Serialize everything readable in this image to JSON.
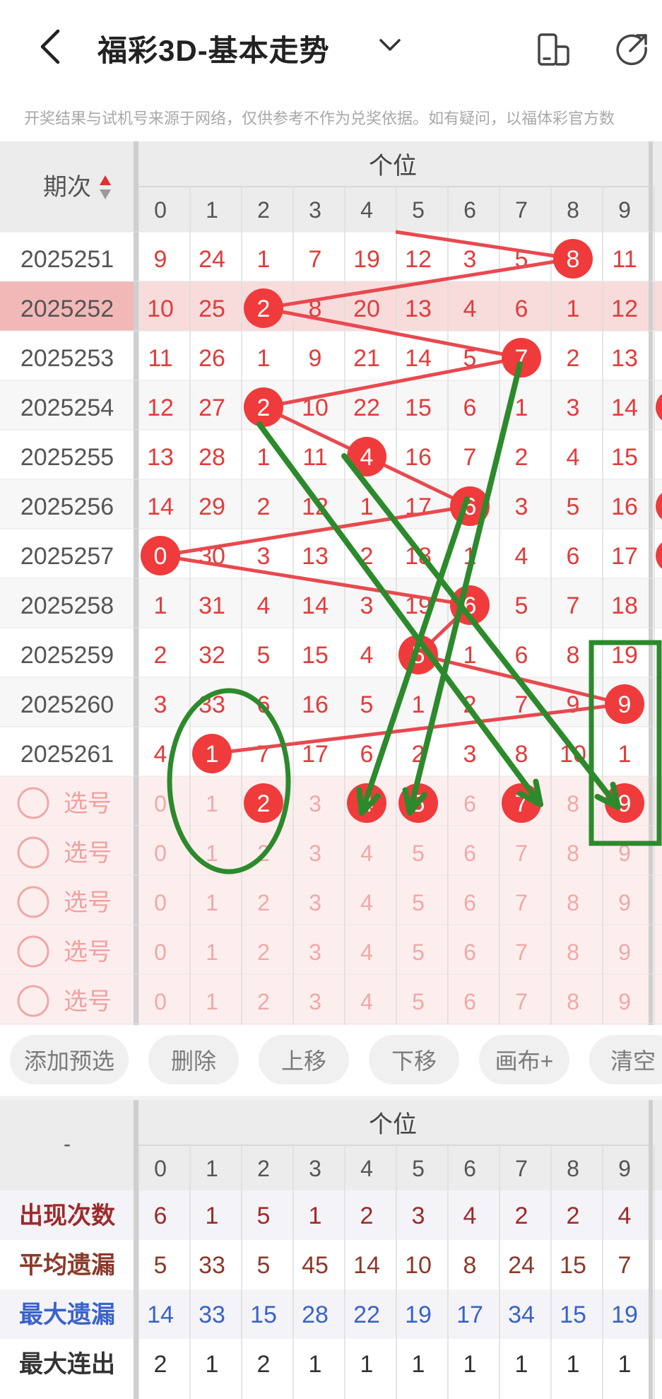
{
  "header": {
    "title": "福彩3D-基本走势",
    "disclaimer": "开奖结果与试机号来源于网络，仅供参考不作为兑奖依据。如有疑问，以福体彩官方数"
  },
  "grid": {
    "period_header": "期次",
    "section_title": "个位",
    "digits": [
      "0",
      "1",
      "2",
      "3",
      "4",
      "5",
      "6",
      "7",
      "8",
      "9"
    ],
    "rows": [
      {
        "period": "2025251",
        "cells": [
          "9",
          "24",
          "1",
          "7",
          "19",
          "12",
          "3",
          "5",
          "8",
          "11"
        ],
        "hit": 8
      },
      {
        "period": "2025252",
        "cells": [
          "10",
          "25",
          "2",
          "8",
          "20",
          "13",
          "4",
          "6",
          "1",
          "12"
        ],
        "hit": 2
      },
      {
        "period": "2025253",
        "cells": [
          "11",
          "26",
          "1",
          "9",
          "21",
          "14",
          "5",
          "7",
          "2",
          "13"
        ],
        "hit": 7
      },
      {
        "period": "2025254",
        "cells": [
          "12",
          "27",
          "2",
          "10",
          "22",
          "15",
          "6",
          "1",
          "3",
          "14"
        ],
        "hit": 2
      },
      {
        "period": "2025255",
        "cells": [
          "13",
          "28",
          "1",
          "11",
          "4",
          "16",
          "7",
          "2",
          "4",
          "15"
        ],
        "hit": 4
      },
      {
        "period": "2025256",
        "cells": [
          "14",
          "29",
          "2",
          "12",
          "1",
          "17",
          "6",
          "3",
          "5",
          "16"
        ],
        "hit": 6
      },
      {
        "period": "2025257",
        "cells": [
          "0",
          "30",
          "3",
          "13",
          "2",
          "18",
          "1",
          "4",
          "6",
          "17"
        ],
        "hit": 0
      },
      {
        "period": "2025258",
        "cells": [
          "1",
          "31",
          "4",
          "14",
          "3",
          "19",
          "6",
          "5",
          "7",
          "18"
        ],
        "hit": 6
      },
      {
        "period": "2025259",
        "cells": [
          "2",
          "32",
          "5",
          "15",
          "4",
          "5",
          "1",
          "6",
          "8",
          "19"
        ],
        "hit": 5
      },
      {
        "period": "2025260",
        "cells": [
          "3",
          "33",
          "6",
          "16",
          "5",
          "1",
          "2",
          "7",
          "9",
          "9"
        ],
        "hit": 9
      },
      {
        "period": "2025261",
        "cells": [
          "4",
          "1",
          "7",
          "17",
          "6",
          "2",
          "3",
          "8",
          "10",
          "1"
        ],
        "hit": 1
      }
    ],
    "select_label": "选号",
    "select_rows": [
      {
        "selected": [
          2,
          4,
          5,
          7,
          9
        ]
      },
      {
        "selected": []
      },
      {
        "selected": []
      },
      {
        "selected": []
      },
      {
        "selected": []
      }
    ]
  },
  "actions": [
    "添加预选",
    "删除",
    "上移",
    "下移",
    "画布+",
    "清空"
  ],
  "stats": {
    "corner": "-",
    "section_title": "个位",
    "rows": [
      {
        "label": "出现次数",
        "values": [
          "6",
          "1",
          "5",
          "1",
          "2",
          "3",
          "4",
          "2",
          "2",
          "4"
        ],
        "color": "#9e2a2a"
      },
      {
        "label": "平均遗漏",
        "values": [
          "5",
          "33",
          "5",
          "45",
          "14",
          "10",
          "8",
          "24",
          "15",
          "7"
        ],
        "color": "#8a3a2a"
      },
      {
        "label": "最大遗漏",
        "values": [
          "14",
          "33",
          "15",
          "28",
          "22",
          "19",
          "17",
          "34",
          "15",
          "19"
        ],
        "color": "#3a63c8"
      },
      {
        "label": "最大连出",
        "values": [
          "2",
          "1",
          "2",
          "1",
          "1",
          "1",
          "1",
          "1",
          "1",
          "1"
        ],
        "color": "#333333"
      }
    ]
  },
  "colors": {
    "ball": "#ef3b3b",
    "trend_line": "#e8494f",
    "annotation": "#2c8a2c",
    "number_red": "#e23c3c",
    "highlight_row": "#f8dcdc",
    "select_bg": "#fdeeee"
  }
}
